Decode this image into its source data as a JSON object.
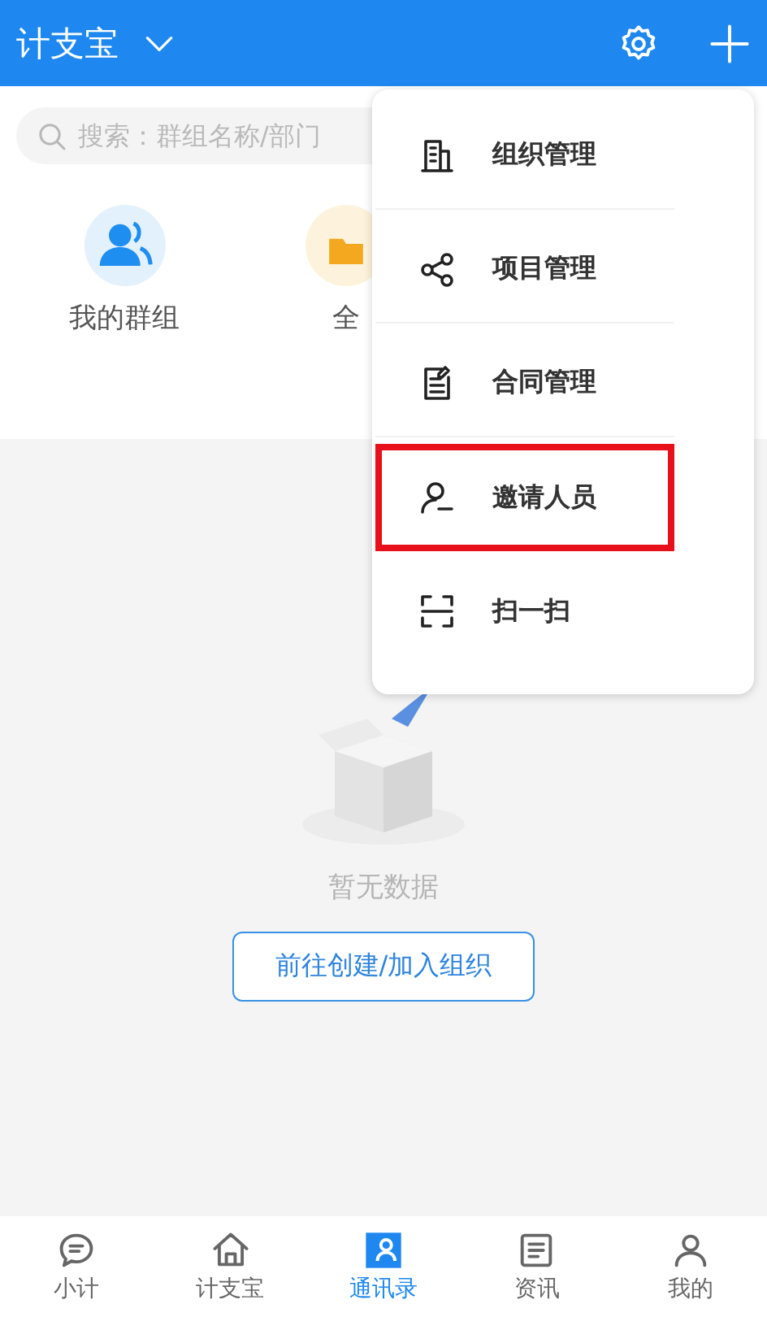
{
  "header": {
    "title": "计支宝"
  },
  "search": {
    "placeholder": "搜索：群组名称/部门"
  },
  "groups": [
    {
      "kind": "people",
      "label": "我的群组"
    },
    {
      "kind": "folder",
      "label": "全"
    }
  ],
  "empty_state": {
    "message": "暂无数据",
    "button": "前往创建/加入组织"
  },
  "menu": [
    {
      "kind": "building",
      "label": "组织管理",
      "highlighted": false
    },
    {
      "kind": "share",
      "label": "项目管理",
      "highlighted": false
    },
    {
      "kind": "document",
      "label": "合同管理",
      "highlighted": false
    },
    {
      "kind": "person",
      "label": "邀请人员",
      "highlighted": true
    },
    {
      "kind": "scan",
      "label": "扫一扫",
      "highlighted": false
    }
  ],
  "tabs": [
    {
      "kind": "chat",
      "label": "小计",
      "selected": false
    },
    {
      "kind": "home",
      "label": "计支宝",
      "selected": false
    },
    {
      "kind": "contacts",
      "label": "通讯录",
      "selected": true
    },
    {
      "kind": "news",
      "label": "资讯",
      "selected": false
    },
    {
      "kind": "me",
      "label": "我的",
      "selected": false
    }
  ]
}
